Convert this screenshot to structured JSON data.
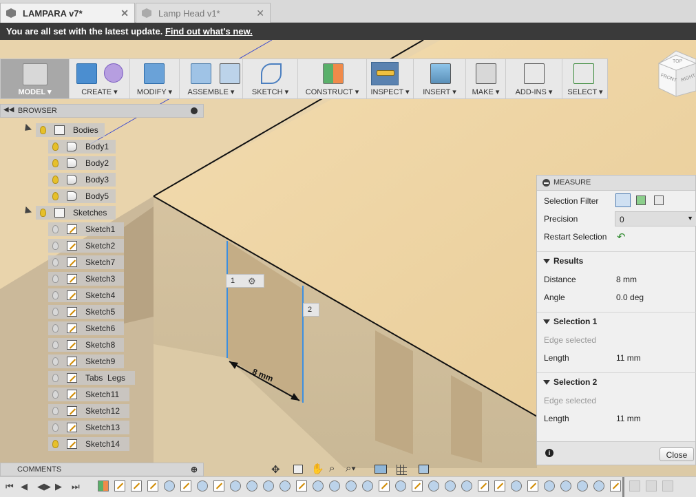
{
  "tabs": [
    {
      "title": "LAMPARA v7*",
      "active": true
    },
    {
      "title": "Lamp Head v1*",
      "active": false
    }
  ],
  "banner": {
    "text": "You are all set with the latest update.",
    "link": "Find out what's new."
  },
  "toolbar": {
    "groups": [
      {
        "label": "MODEL",
        "icon": "model-workspace-icon"
      },
      {
        "label": "CREATE",
        "icon": "create-icon"
      },
      {
        "label": "MODIFY",
        "icon": "modify-icon"
      },
      {
        "label": "ASSEMBLE",
        "icon": "assemble-icon"
      },
      {
        "label": "SKETCH",
        "icon": "sketch-icon"
      },
      {
        "label": "CONSTRUCT",
        "icon": "construct-icon"
      },
      {
        "label": "INSPECT",
        "icon": "inspect-icon"
      },
      {
        "label": "INSERT",
        "icon": "insert-icon"
      },
      {
        "label": "MAKE",
        "icon": "make-icon"
      },
      {
        "label": "ADD-INS",
        "icon": "add-ins-icon"
      },
      {
        "label": "SELECT",
        "icon": "select-icon"
      }
    ]
  },
  "browser": {
    "title": "BROWSER",
    "folders": [
      {
        "label": "Bodies",
        "items": [
          "Body1",
          "Body2",
          "Body3",
          "Body5"
        ]
      },
      {
        "label": "Sketches",
        "items": [
          "Sketch1",
          "Sketch2",
          "Sketch7",
          "Sketch3",
          "Sketch4",
          "Sketch5",
          "Sketch6",
          "Sketch8",
          "Sketch9",
          "Tabs  Legs",
          "Sketch11",
          "Sketch12",
          "Sketch13",
          "Sketch14"
        ]
      }
    ]
  },
  "comments": {
    "title": "COMMENTS"
  },
  "viewport": {
    "tag1": "1",
    "tag2": "2",
    "dimension": "8 mm",
    "viewcube": {
      "front": "FRONT",
      "right": "RIGHT",
      "top": "TOP"
    }
  },
  "measure": {
    "title": "MEASURE",
    "selection_filter_label": "Selection Filter",
    "precision_label": "Precision",
    "precision_value": "0",
    "restart_label": "Restart Selection",
    "results": {
      "title": "Results",
      "distance_label": "Distance",
      "distance_value": "8 mm",
      "angle_label": "Angle",
      "angle_value": "0.0 deg"
    },
    "selection1": {
      "title": "Selection 1",
      "status": "Edge selected",
      "length_label": "Length",
      "length_value": "11 mm"
    },
    "selection2": {
      "title": "Selection 2",
      "status": "Edge selected",
      "length_label": "Length",
      "length_value": "11 mm"
    },
    "close_label": "Close"
  },
  "colors": {
    "accent": "#5a82b0",
    "banner_bg": "#3a3a3a",
    "wood": "#e8cfa0",
    "highlight_edge": "#3d8fe0"
  }
}
